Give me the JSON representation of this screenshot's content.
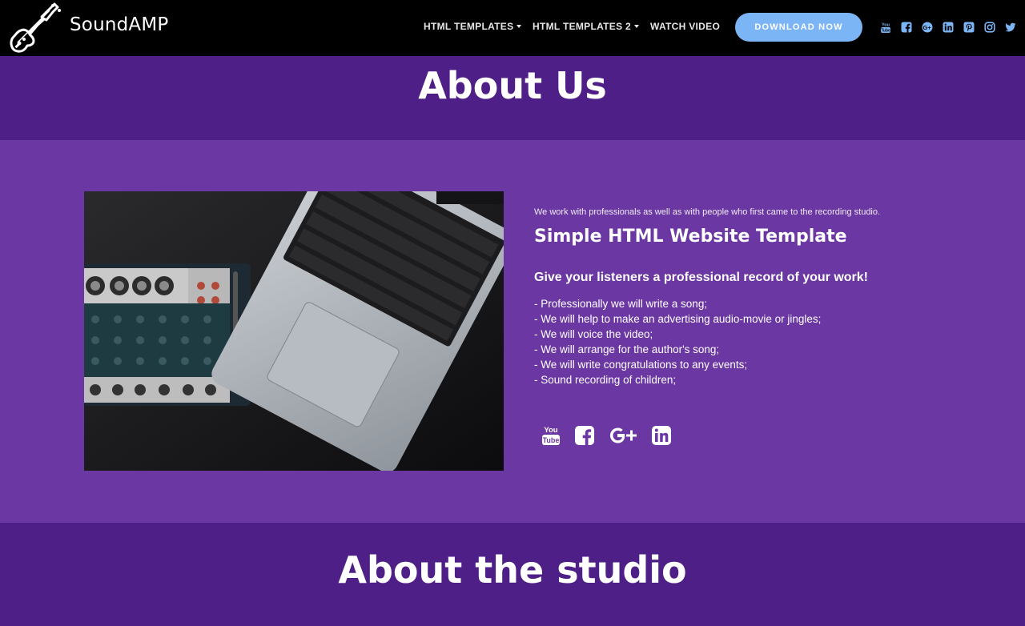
{
  "brand": {
    "name": "SoundAMP"
  },
  "nav": {
    "items": [
      {
        "label": "HTML TEMPLATES",
        "dropdown": true
      },
      {
        "label": "HTML TEMPLATES 2",
        "dropdown": true
      },
      {
        "label": "WATCH VIDEO",
        "dropdown": false
      }
    ],
    "download_label": "DOWNLOAD NOW",
    "social_icons": [
      "youtube-icon",
      "facebook-icon",
      "google-plus-icon",
      "linkedin-icon",
      "pinterest-icon",
      "instagram-icon",
      "twitter-icon"
    ]
  },
  "colors": {
    "navbar": "#000000",
    "dark_band": "#4e1f86",
    "content_band": "#6b37a2",
    "button": "#7cb5f5",
    "social_icons": "#7cb5f5"
  },
  "about": {
    "heading": "About Us",
    "intro": "We work with professionals as well as with people who first came to the recording studio.",
    "title": "Simple HTML Website Template",
    "tagline": "Give your listeners a professional record of your work!",
    "services": [
      "- Professionally we will write a song;",
      "- We will help to make an advertising audio-movie or jingles;",
      "- We will voice the video;",
      "- We will arrange for the author's song;",
      "- We will write congratulations to any events;",
      "- Sound recording of children;"
    ],
    "social_icons": [
      "youtube-icon",
      "facebook-icon",
      "google-plus-icon",
      "linkedin-icon"
    ]
  },
  "studio": {
    "heading": "About the studio"
  }
}
